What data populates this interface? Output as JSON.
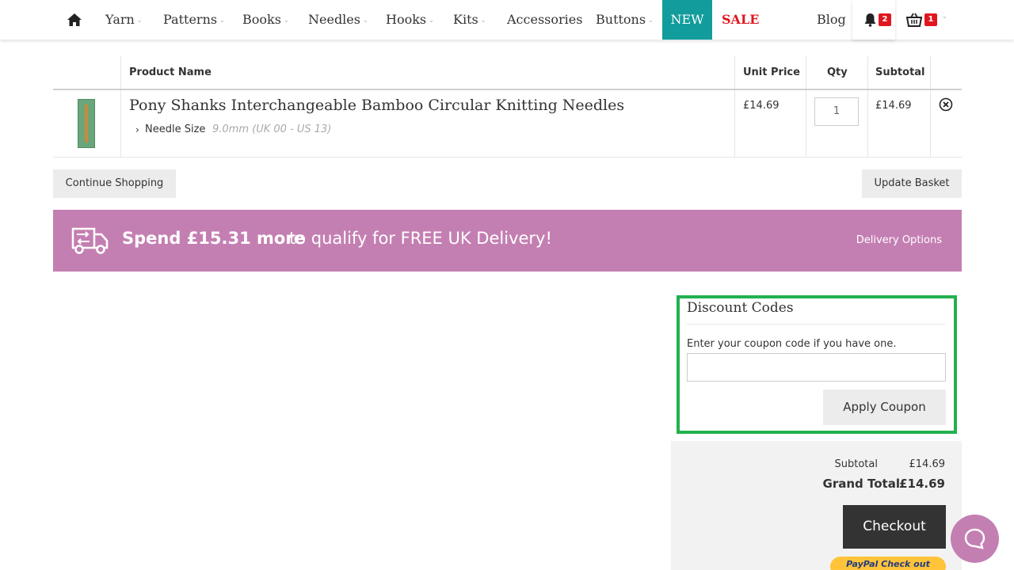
{
  "nav": {
    "items": [
      {
        "label": "Yarn",
        "chevron": true
      },
      {
        "label": "Patterns",
        "chevron": true
      },
      {
        "label": "Books",
        "chevron": true
      },
      {
        "label": "Needles",
        "chevron": true
      },
      {
        "label": "Hooks",
        "chevron": true
      },
      {
        "label": "Kits",
        "chevron": true
      },
      {
        "label": "Accessories",
        "chevron": false
      },
      {
        "label": "Buttons",
        "chevron": true
      }
    ],
    "new_label": "NEW",
    "sale_label": "SALE",
    "blog_label": "Blog",
    "notifications_count": "2",
    "basket_count": "1"
  },
  "cart": {
    "headers": {
      "product_name": "Product Name",
      "unit_price": "Unit Price",
      "qty": "Qty",
      "subtotal": "Subtotal"
    },
    "items": [
      {
        "name": "Pony Shanks Interchangeable Bamboo Circular Knitting Needles",
        "option_label": "Needle Size",
        "option_value": "9.0mm (UK 00 - US 13)",
        "unit_price": "£14.69",
        "qty": "1",
        "subtotal": "£14.69"
      }
    ]
  },
  "actions": {
    "continue_shopping": "Continue Shopping",
    "update_basket": "Update Basket"
  },
  "delivery_banner": {
    "strong_text": "Spend £15.31 more",
    "rest_text": "to qualify for FREE UK Delivery!",
    "link": "Delivery Options"
  },
  "discount": {
    "title": "Discount Codes",
    "help_text": "Enter your coupon code if you have one.",
    "input_value": "",
    "apply_label": "Apply Coupon"
  },
  "totals": {
    "subtotal_label": "Subtotal",
    "subtotal_value": "£14.69",
    "grand_total_label": "Grand Total",
    "grand_total_value": "£14.69",
    "checkout_label": "Checkout",
    "paypal_label": "PayPal Check out"
  },
  "colors": {
    "teal": "#129c9c",
    "sale_red": "#e0171f",
    "banner_purple": "#c47fb2",
    "highlight_green": "#21b14f"
  }
}
